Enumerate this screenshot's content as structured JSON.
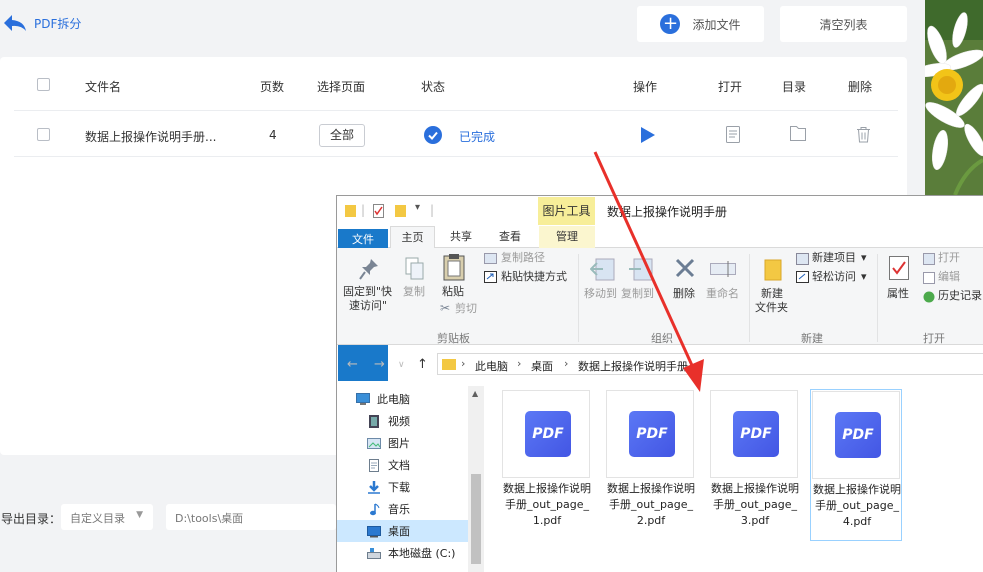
{
  "app": {
    "back_label": "PDF拆分",
    "add_file": "添加文件",
    "clear_list": "清空列表",
    "columns": [
      "文件名",
      "页数",
      "选择页面",
      "状态",
      "操作",
      "打开",
      "目录",
      "删除"
    ],
    "rows": [
      {
        "filename": "数据上报操作说明手册...",
        "pages": "4",
        "select_pages": "全部",
        "status": "已完成"
      }
    ],
    "output_label": "导出目录：",
    "output_mode": "自定义目录",
    "output_path": "D:\\tools\\桌面"
  },
  "explorer": {
    "contextual_tab": "图片工具",
    "title": "数据上报操作说明手册",
    "tabs": [
      "文件",
      "主页",
      "共享",
      "查看",
      "管理"
    ],
    "ribbon": {
      "pin_line1": "固定到\"快",
      "pin_line2": "速访问\"",
      "copy": "复制",
      "paste": "粘贴",
      "copy_path": "复制路径",
      "paste_shortcut": "粘贴快捷方式",
      "cut": "剪切",
      "group_clipboard": "剪贴板",
      "move_to": "移动到",
      "copy_to": "复制到",
      "delete": "删除",
      "rename": "重命名",
      "group_organize": "组织",
      "new_item": "新建项目",
      "easy_access": "轻松访问",
      "new_folder_line1": "新建",
      "new_folder_line2": "文件夹",
      "group_new": "新建",
      "properties": "属性",
      "open": "打开",
      "edit": "编辑",
      "history": "历史记录",
      "group_open": "打开"
    },
    "breadcrumb": [
      "此电脑",
      "桌面",
      "数据上报操作说明手册"
    ],
    "nav": [
      {
        "label": "此电脑",
        "icon": "computer-icon"
      },
      {
        "label": "视频",
        "icon": "video-icon"
      },
      {
        "label": "图片",
        "icon": "picture-icon"
      },
      {
        "label": "文档",
        "icon": "document-icon"
      },
      {
        "label": "下载",
        "icon": "download-icon"
      },
      {
        "label": "音乐",
        "icon": "music-icon"
      },
      {
        "label": "桌面",
        "icon": "desktop-icon"
      },
      {
        "label": "本地磁盘 (C:)",
        "icon": "drive-icon"
      }
    ],
    "files": [
      {
        "name": "数据上报操作说明手册_out_page_1.pdf",
        "icon_text": "PDF"
      },
      {
        "name": "数据上报操作说明手册_out_page_2.pdf",
        "icon_text": "PDF"
      },
      {
        "name": "数据上报操作说明手册_out_page_3.pdf",
        "icon_text": "PDF"
      },
      {
        "name": "数据上报操作说明手册_out_page_4.pdf",
        "icon_text": "PDF"
      }
    ]
  },
  "colors": {
    "accent": "#2a6fdc",
    "file_tab": "#1979ca",
    "tools_tab": "#f7ee99",
    "annotation_arrow": "#e8302a"
  }
}
